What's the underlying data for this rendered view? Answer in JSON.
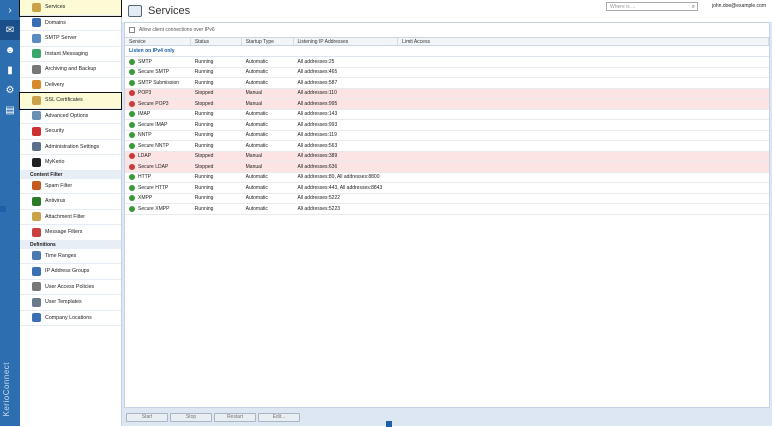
{
  "rail": {
    "brand": "KerioConnect"
  },
  "sidebar": {
    "items_top": [
      {
        "label": "Services",
        "icon": "services-icon",
        "highlight": true
      },
      {
        "label": "Domains",
        "icon": "at-icon"
      },
      {
        "label": "SMTP Server",
        "icon": "smtp-icon"
      },
      {
        "label": "Instant Messaging",
        "icon": "chat-icon"
      },
      {
        "label": "Archiving and Backup",
        "icon": "archive-icon"
      },
      {
        "label": "Delivery",
        "icon": "delivery-icon"
      },
      {
        "label": "SSL Certificates",
        "icon": "certificate-icon",
        "highlight": true
      },
      {
        "label": "Advanced Options",
        "icon": "options-icon"
      },
      {
        "label": "Security",
        "icon": "security-icon"
      },
      {
        "label": "Administration Settings",
        "icon": "admin-icon"
      },
      {
        "label": "MyKerio",
        "icon": "mykerio-icon"
      }
    ],
    "section_content": "Content Filter",
    "items_content": [
      {
        "label": "Spam Filter",
        "icon": "spam-icon"
      },
      {
        "label": "Antivirus",
        "icon": "antivirus-icon"
      },
      {
        "label": "Attachment Filter",
        "icon": "attachment-icon"
      },
      {
        "label": "Message Filters",
        "icon": "filter-icon"
      }
    ],
    "section_definitions": "Definitions",
    "items_definitions": [
      {
        "label": "Time Ranges",
        "icon": "clock-icon"
      },
      {
        "label": "IP Address Groups",
        "icon": "ip-icon"
      },
      {
        "label": "User Access Policies",
        "icon": "policy-icon"
      },
      {
        "label": "User Templates",
        "icon": "template-icon"
      },
      {
        "label": "Company Locations",
        "icon": "location-icon"
      }
    ]
  },
  "header": {
    "title": "Services",
    "search_placeholder": "Where is ...",
    "user": "john.doe@example.com"
  },
  "ipv6_label": "Allow client connections over IPv6",
  "table": {
    "columns": [
      "Service",
      "Status",
      "Startup Type",
      "Listening IP Addresses",
      "Limit Access"
    ],
    "group": "Listen on IPv4 only",
    "rows": [
      {
        "service": "SMTP",
        "status": "Running",
        "startup": "Automatic",
        "addr": "All addresses:25"
      },
      {
        "service": "Secure SMTP",
        "status": "Running",
        "startup": "Automatic",
        "addr": "All addresses:465"
      },
      {
        "service": "SMTP Submission",
        "status": "Running",
        "startup": "Automatic",
        "addr": "All addresses:587"
      },
      {
        "service": "POP3",
        "status": "Stopped",
        "startup": "Manual",
        "addr": "All addresses:110"
      },
      {
        "service": "Secure POP3",
        "status": "Stopped",
        "startup": "Manual",
        "addr": "All addresses:995"
      },
      {
        "service": "IMAP",
        "status": "Running",
        "startup": "Automatic",
        "addr": "All addresses:143"
      },
      {
        "service": "Secure IMAP",
        "status": "Running",
        "startup": "Automatic",
        "addr": "All addresses:993"
      },
      {
        "service": "NNTP",
        "status": "Running",
        "startup": "Automatic",
        "addr": "All addresses:119"
      },
      {
        "service": "Secure NNTP",
        "status": "Running",
        "startup": "Automatic",
        "addr": "All addresses:563"
      },
      {
        "service": "LDAP",
        "status": "Stopped",
        "startup": "Manual",
        "addr": "All addresses:389"
      },
      {
        "service": "Secure LDAP",
        "status": "Stopped",
        "startup": "Manual",
        "addr": "All addresses:636"
      },
      {
        "service": "HTTP",
        "status": "Running",
        "startup": "Automatic",
        "addr": "All addresses:80, All addresses:8800"
      },
      {
        "service": "Secure HTTP",
        "status": "Running",
        "startup": "Automatic",
        "addr": "All addresses:443, All addresses:8843"
      },
      {
        "service": "XMPP",
        "status": "Running",
        "startup": "Automatic",
        "addr": "All addresses:5222"
      },
      {
        "service": "Secure XMPP",
        "status": "Running",
        "startup": "Automatic",
        "addr": "All addresses:5223"
      }
    ]
  },
  "buttons": [
    "Start",
    "Stop",
    "Restart",
    "Edit..."
  ],
  "colors": {
    "rail": "#2d6eb0",
    "running": "#3a9a3a",
    "stopped": "#c93a3a",
    "stopped_row": "#fce4e4"
  }
}
